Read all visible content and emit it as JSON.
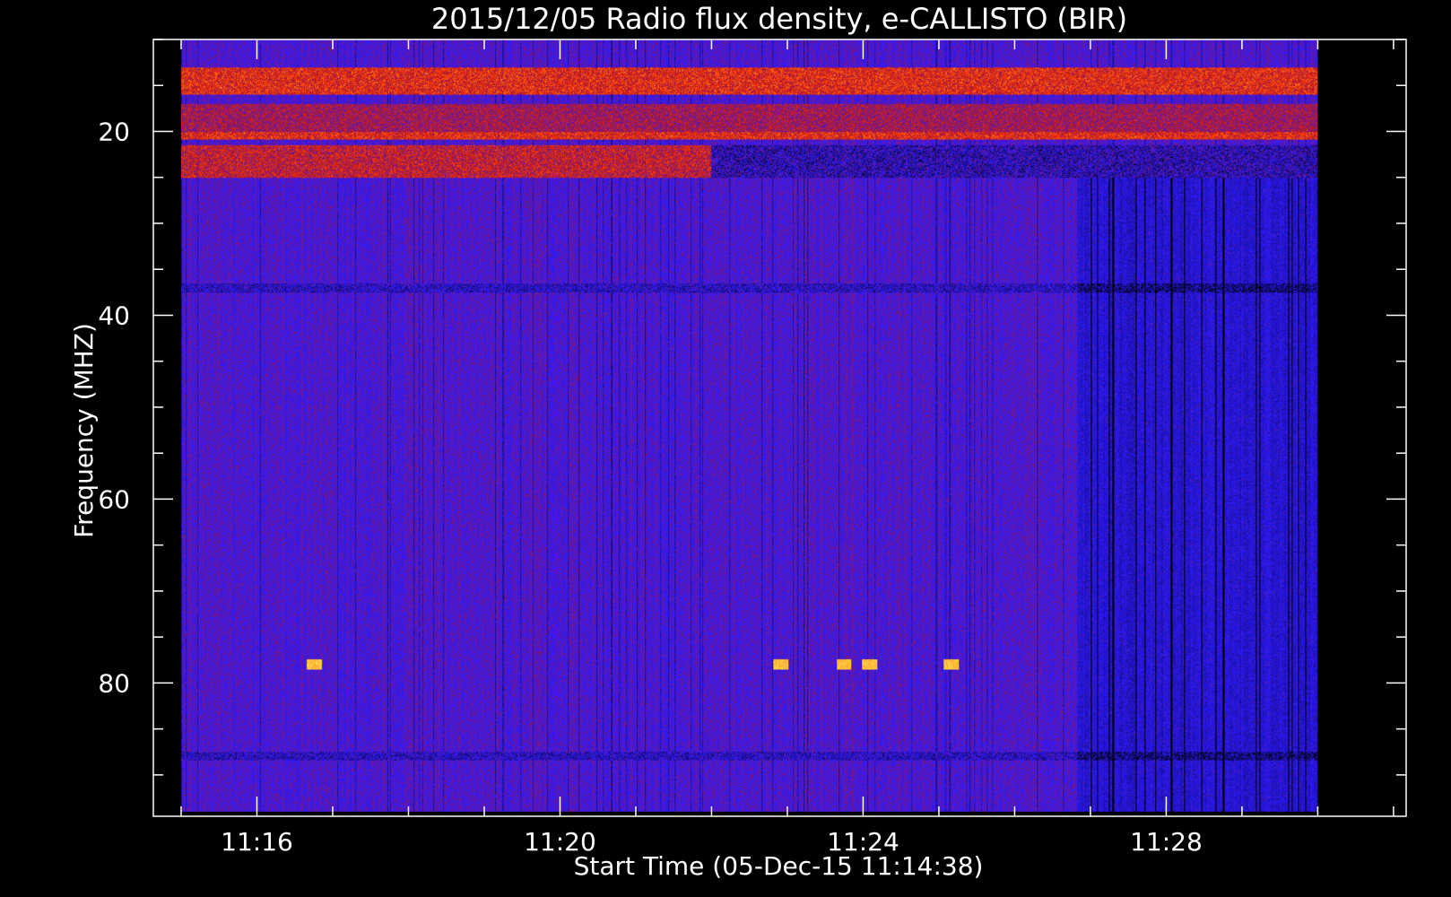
{
  "chart_data": {
    "type": "heatmap",
    "title": "2015/12/05  Radio flux density, e-CALLISTO (BIR)",
    "xlabel": "Start Time (05-Dec-15 11:14:38)",
    "ylabel": "Frequency (MHZ)",
    "x_tick_labels": [
      "11:16",
      "11:20",
      "11:24",
      "11:28"
    ],
    "y_tick_labels": [
      "20",
      "40",
      "60",
      "80"
    ],
    "y_ticks": [
      20,
      40,
      60,
      80
    ],
    "ylim": [
      94.5,
      10
    ],
    "xlim": [
      "11:14:38",
      "11:31:10"
    ],
    "data_range_x": [
      "11:15:00",
      "11:30:00"
    ],
    "data_range_y": [
      10,
      94
    ],
    "colormap": [
      "#000000",
      "#2a1aff",
      "#b2162e",
      "#ff3a00",
      "#ffe64c"
    ],
    "colors": {
      "background": "#000000",
      "axes": "#ffffff"
    },
    "features": [
      {
        "kind": "band",
        "freq": [
          13,
          16
        ],
        "level": "hot"
      },
      {
        "kind": "band",
        "freq": [
          17,
          20
        ],
        "level": "warm"
      },
      {
        "kind": "band",
        "freq": [
          20,
          20.8
        ],
        "level": "hot"
      },
      {
        "kind": "band",
        "freq": [
          21.5,
          25
        ],
        "level": "hot-dark"
      },
      {
        "kind": "line",
        "freq": 37,
        "level": "dark"
      },
      {
        "kind": "line",
        "freq": 88,
        "level": "dark"
      },
      {
        "kind": "burst",
        "time": "11:16:45",
        "freq": 78,
        "level": "hot"
      },
      {
        "kind": "burst",
        "time": "11:22:55",
        "freq": 78,
        "level": "hot"
      },
      {
        "kind": "burst",
        "time": "11:23:45",
        "freq": 78,
        "level": "hot"
      },
      {
        "kind": "burst",
        "time": "11:24:05",
        "freq": 78,
        "level": "hot"
      },
      {
        "kind": "burst",
        "time": "11:25:10",
        "freq": 78,
        "level": "hot"
      },
      {
        "kind": "dark_region",
        "time": [
          "11:26:50",
          "11:30:00"
        ],
        "level": "dark"
      }
    ]
  }
}
